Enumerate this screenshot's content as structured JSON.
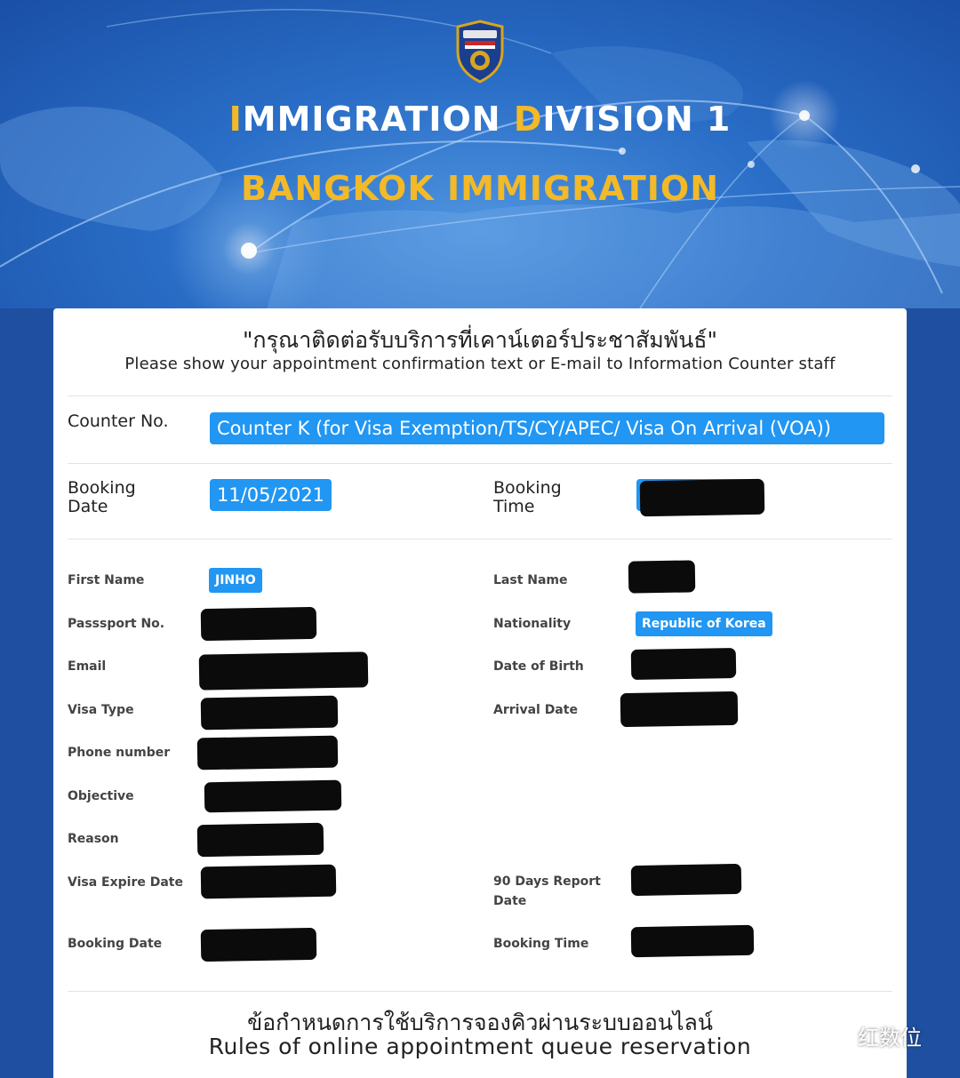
{
  "header": {
    "title_line1_first_letter": "I",
    "title_line1_part1": "MMIGRATION ",
    "title_line1_second_letter": "D",
    "title_line1_part2": "IVISION 1",
    "title_line2": "BANGKOK IMMIGRATION",
    "badge_icon": "royal-thai-police-badge-icon",
    "colors": {
      "gold": "#f2b928",
      "banner_blue": "#2a6ec7"
    }
  },
  "notice": {
    "thai": "\"กรุณาติดต่อรับบริการที่เคาน์เตอร์ประชาสัมพันธ์\"",
    "english": "Please show your appointment confirmation text or E-mail to Information Counter staff"
  },
  "counter": {
    "label": "Counter No.",
    "value": "Counter K (for Visa Exemption/TS/CY/APEC/ Visa On Arrival (VOA))"
  },
  "booking_top": {
    "date_label_line1": "Booking",
    "date_label_line2": "Date",
    "date_value": "11/05/2021",
    "time_label_line1": "Booking",
    "time_label_line2": "Time"
  },
  "details": {
    "first_name_label": "First Name",
    "first_name_value": "JINHO",
    "last_name_label": "Last Name",
    "passport_label": "Passsport No.",
    "nationality_label": "Nationality",
    "nationality_value": "Republic of Korea",
    "email_label": "Email",
    "dob_label": "Date of Birth",
    "visa_type_label": "Visa Type",
    "arrival_label": "Arrival Date",
    "phone_label": "Phone number",
    "objective_label": "Objective",
    "reason_label": "Reason",
    "visa_expire_label": "Visa Expire Date",
    "report_label_line1": "90 Days Report",
    "report_label_line2": "Date",
    "booking_date_label": "Booking Date",
    "booking_time_label": "Booking Time"
  },
  "rules": {
    "thai": "ข้อกำหนดการใช้บริการจองคิวผ่านระบบออนไลน์",
    "english": "Rules of online appointment queue reservation"
  },
  "watermark": {
    "icon": "wechat-icon",
    "text": "红数位"
  },
  "colors": {
    "pill_blue": "#2196f3"
  }
}
